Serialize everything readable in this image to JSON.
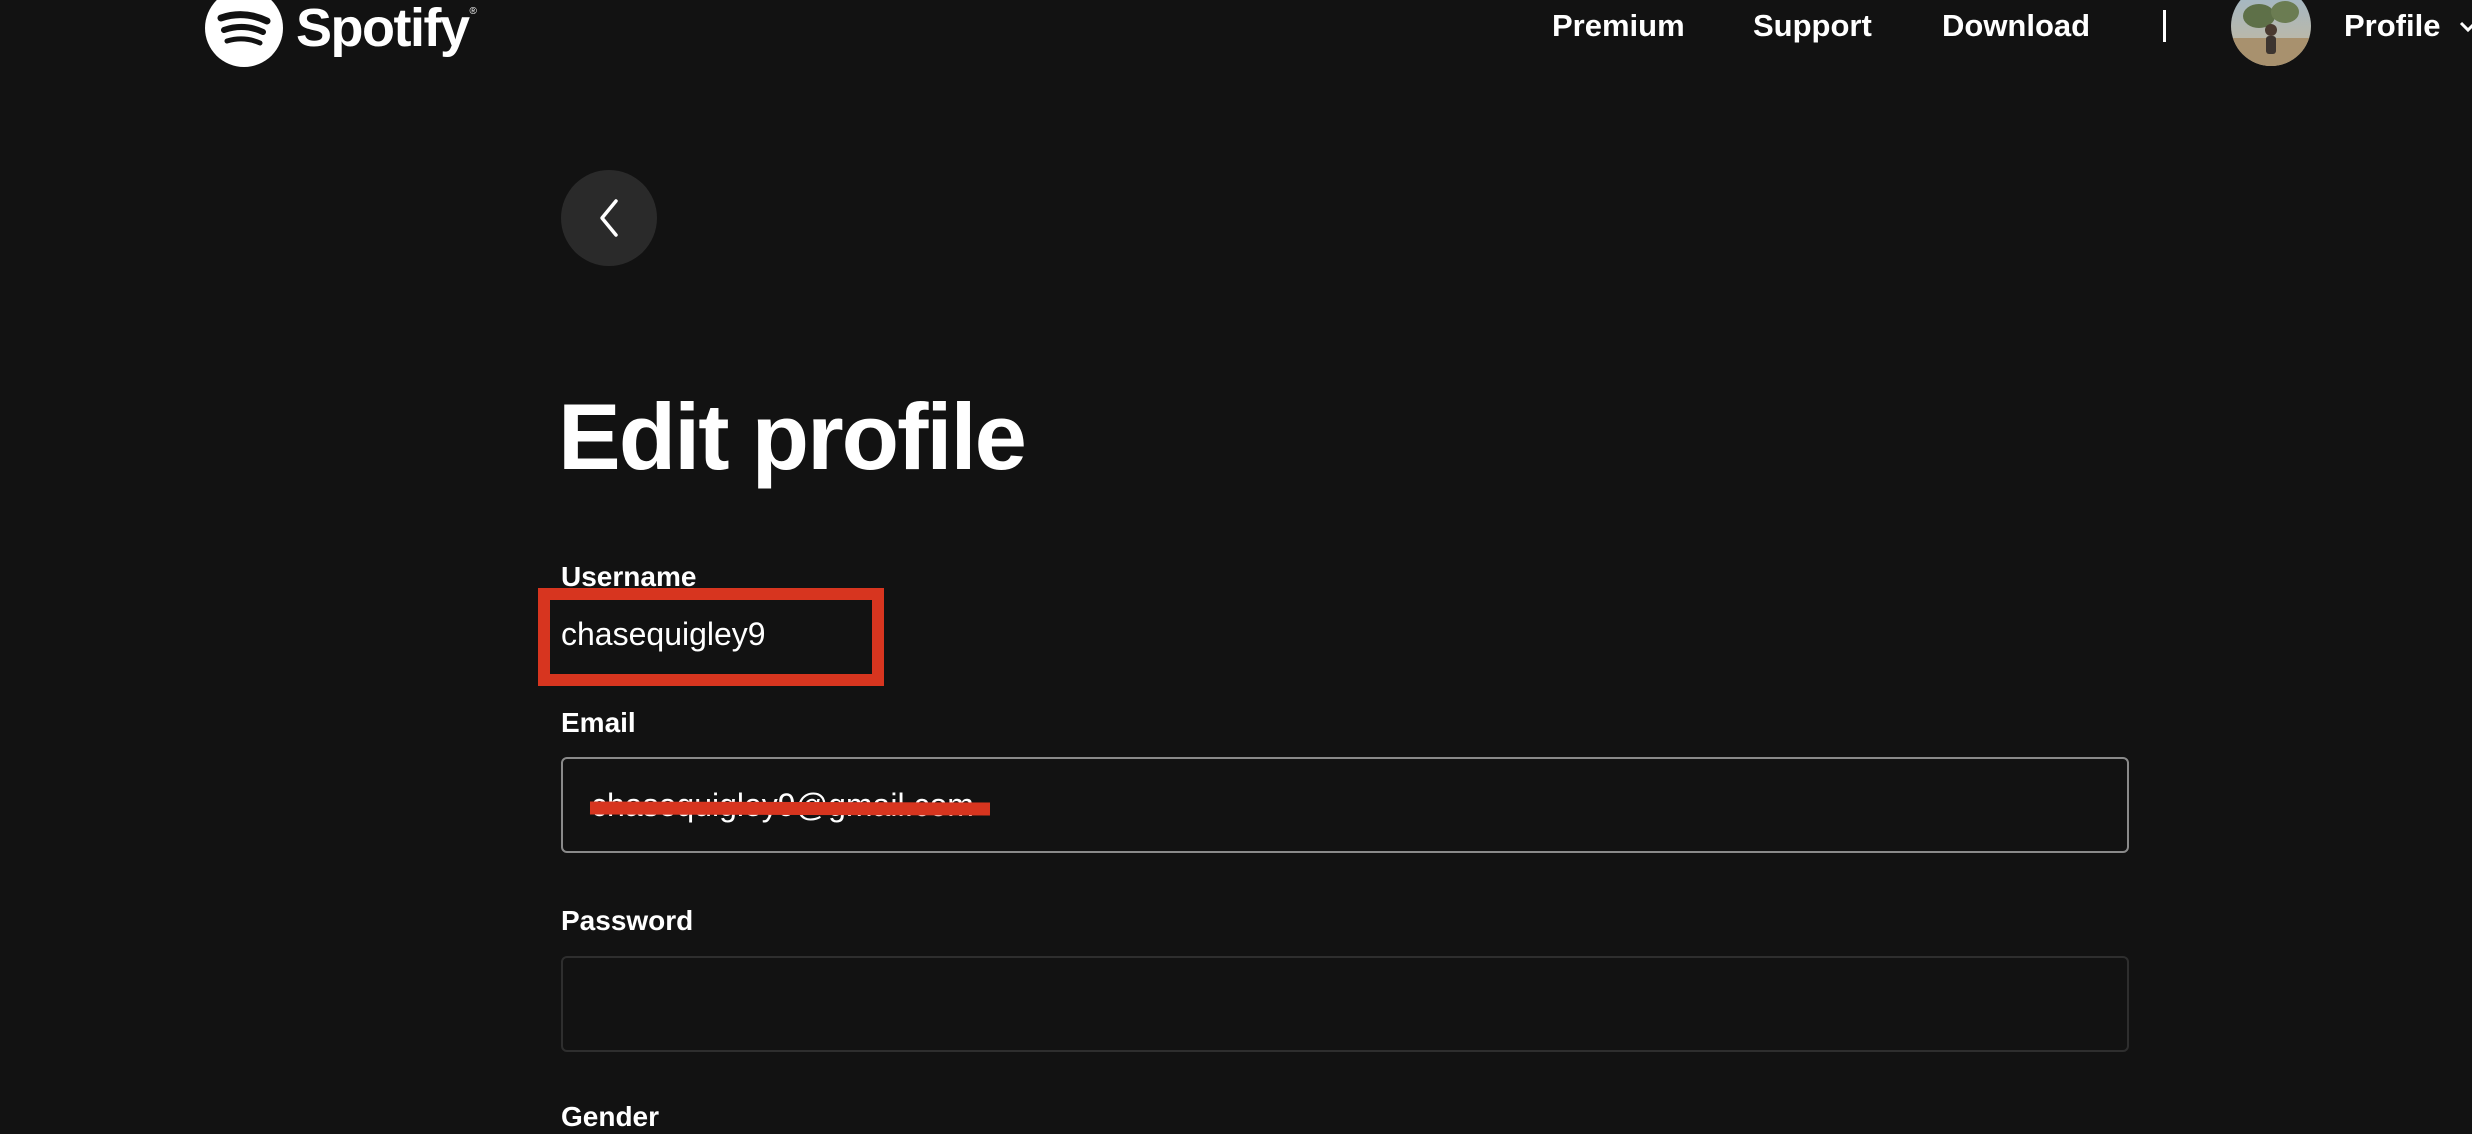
{
  "brand": {
    "name": "Spotify",
    "trademark": "®",
    "color": "#1ed760"
  },
  "nav": {
    "premium": "Premium",
    "support": "Support",
    "download": "Download",
    "profile": "Profile"
  },
  "page": {
    "title": "Edit profile"
  },
  "form": {
    "username": {
      "label": "Username",
      "value": "chasequigley9"
    },
    "email": {
      "label": "Email",
      "value": "chasequigley9@gmail.com",
      "redacted": true
    },
    "password": {
      "label": "Password",
      "value": ""
    },
    "gender": {
      "label": "Gender"
    }
  },
  "colors": {
    "background": "#121212",
    "annotation": "#d7351f",
    "back_button": "#2a2a2a"
  }
}
